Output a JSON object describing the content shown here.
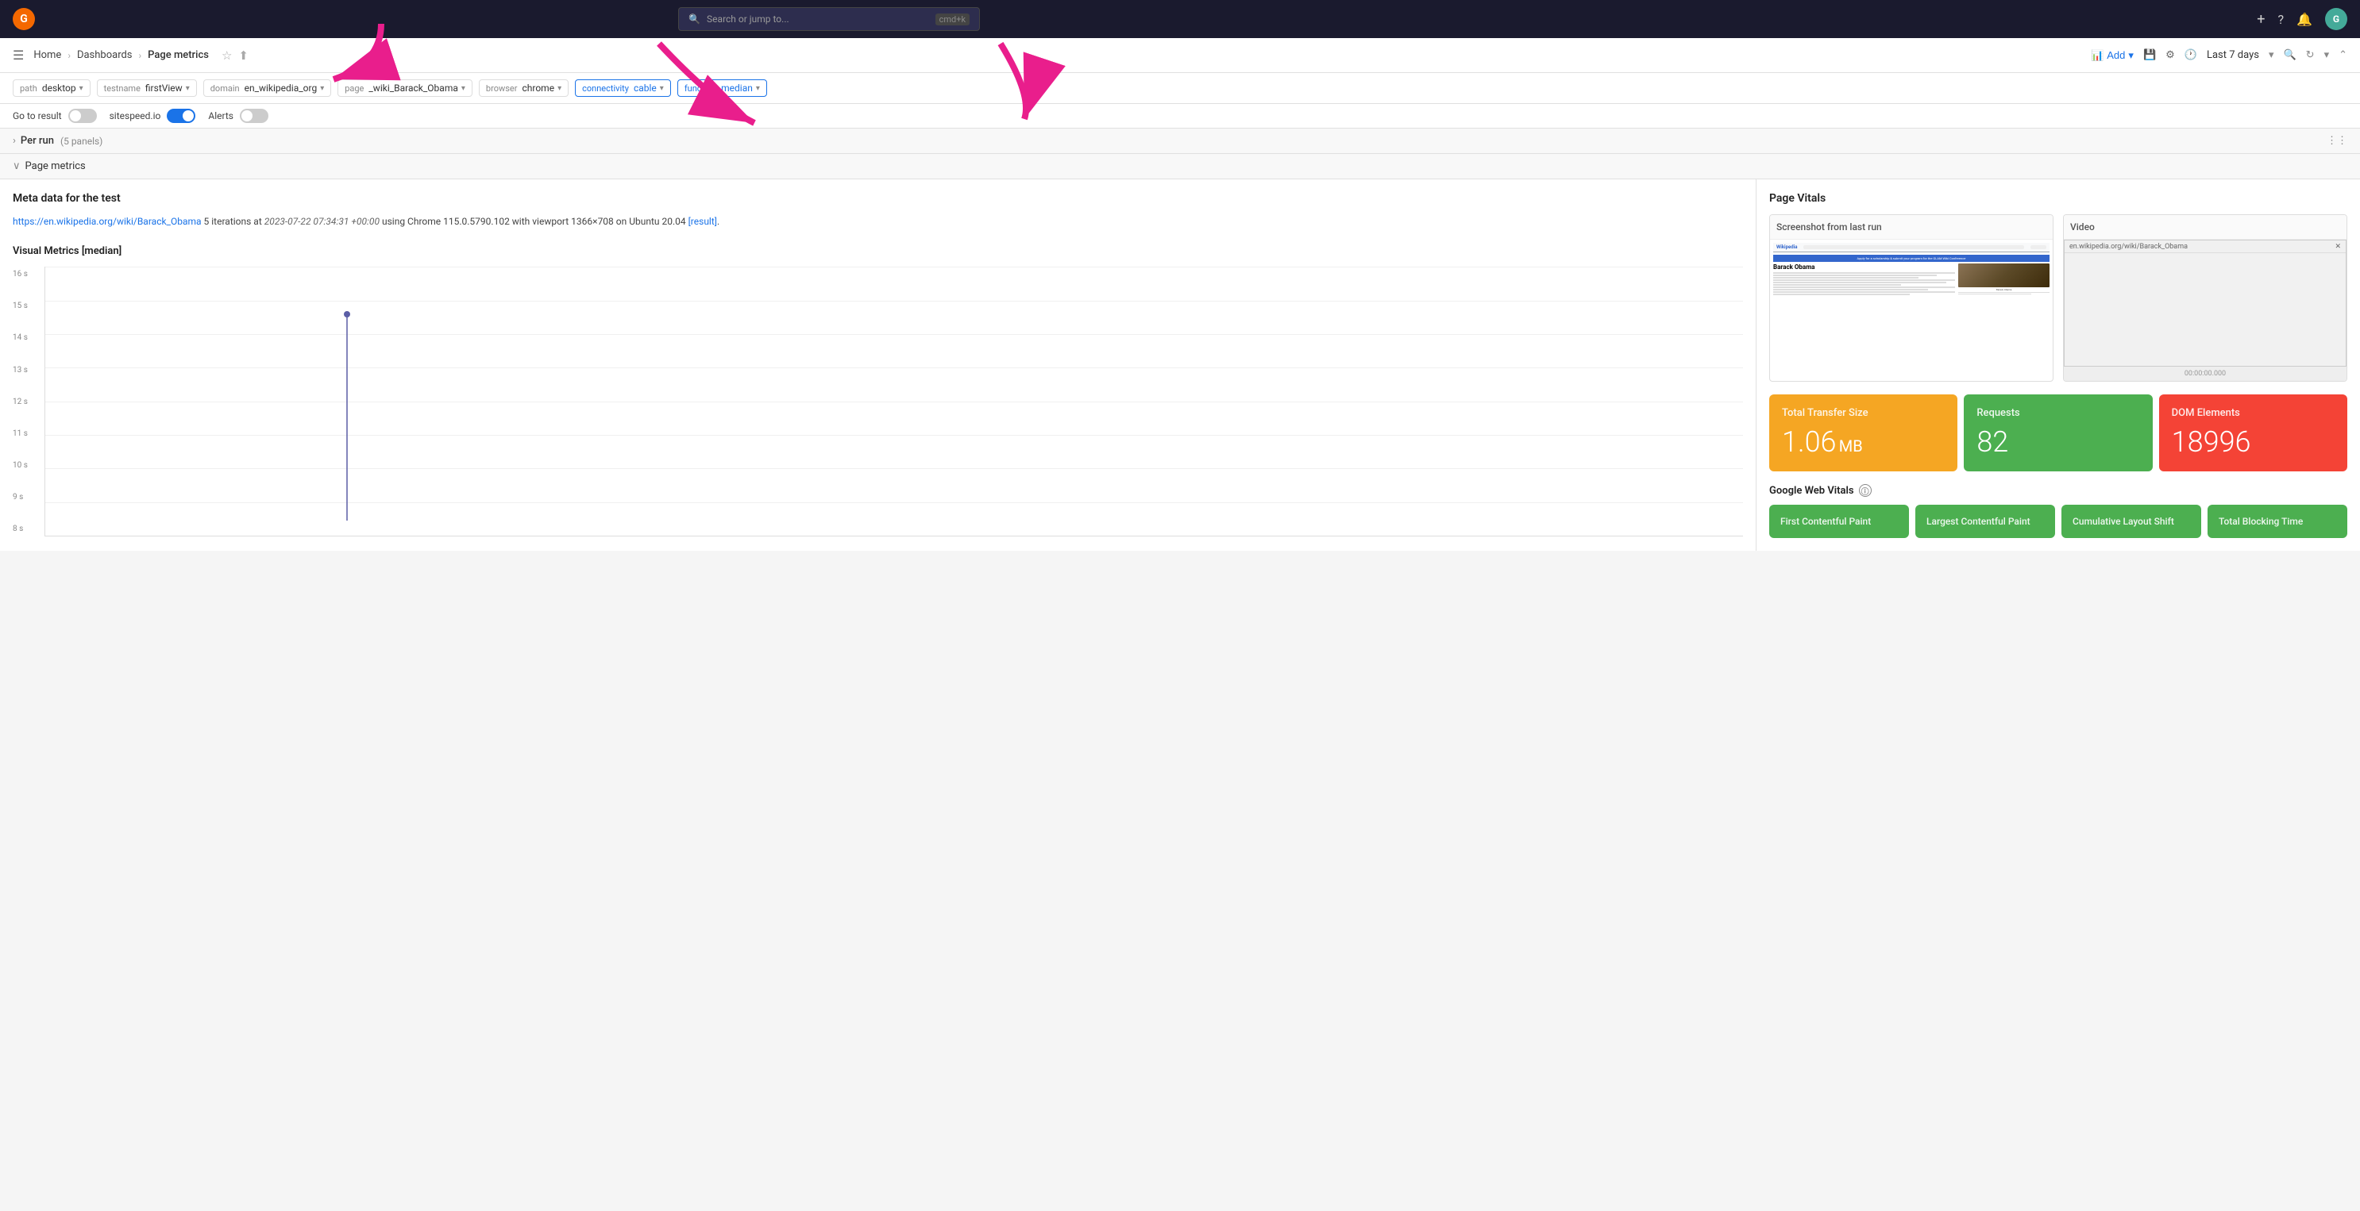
{
  "app": {
    "logo": "G",
    "search_placeholder": "Search or jump to...",
    "search_shortcut": "cmd+k"
  },
  "nav": {
    "add_label": "Add",
    "last_7_days_label": "Last 7 days",
    "breadcrumbs": [
      "Home",
      "Dashboards",
      "Page metrics"
    ]
  },
  "filters": [
    {
      "id": "path",
      "label": "path",
      "value": "desktop"
    },
    {
      "id": "testname",
      "label": "testname",
      "value": "firstView"
    },
    {
      "id": "domain",
      "label": "domain",
      "value": "en_wikipedia_org"
    },
    {
      "id": "page",
      "label": "page",
      "value": "_wiki_Barack_Obama"
    },
    {
      "id": "browser",
      "label": "browser",
      "value": "chrome"
    },
    {
      "id": "connectivity",
      "label": "connectivity",
      "value": "cable"
    },
    {
      "id": "function",
      "label": "function",
      "value": "median"
    }
  ],
  "toggles": {
    "go_to_result_label": "Go to result",
    "go_to_result_value": false,
    "sitespeed_label": "sitespeed.io",
    "sitespeed_value": true,
    "alerts_label": "Alerts",
    "alerts_value": false
  },
  "per_run_section": {
    "title": "Per run",
    "subtitle": "(5 panels)",
    "collapsed": false
  },
  "page_metrics_section": {
    "title": "Page metrics",
    "collapsed": false
  },
  "meta": {
    "title": "Meta data for the test",
    "url": "https://en.wikipedia.org/wiki/Barack_Obama",
    "description": "5 iterations at",
    "timestamp": "2023-07-22 07:34:31 +00:00",
    "rest": "using Chrome 115.0.5790.102 with viewport 1366×708 on Ubuntu 20.04",
    "result_link": "[result]"
  },
  "chart": {
    "title": "Visual Metrics [median]",
    "y_labels": [
      "16 s",
      "15 s",
      "14 s",
      "13 s",
      "12 s",
      "11 s",
      "10 s",
      "9 s",
      "8 s"
    ]
  },
  "page_vitals": {
    "title": "Page Vitals",
    "screenshot_label": "Screenshot from last run",
    "video_label": "Video",
    "video_timeline": "00:00:00.000"
  },
  "stats": [
    {
      "label": "Total Transfer Size",
      "value": "1.06",
      "unit": "MB",
      "color": "yellow"
    },
    {
      "label": "Requests",
      "value": "82",
      "unit": "",
      "color": "green"
    },
    {
      "label": "DOM Elements",
      "value": "18996",
      "unit": "",
      "color": "red"
    }
  ],
  "google_web_vitals": {
    "title": "Google Web Vitals",
    "cards": [
      {
        "label": "First Contentful Paint",
        "color": "green"
      },
      {
        "label": "Largest Contentful Paint",
        "color": "green"
      },
      {
        "label": "Cumulative Layout Shift",
        "color": "green"
      },
      {
        "label": "Total Blocking Time",
        "color": "green"
      }
    ]
  }
}
